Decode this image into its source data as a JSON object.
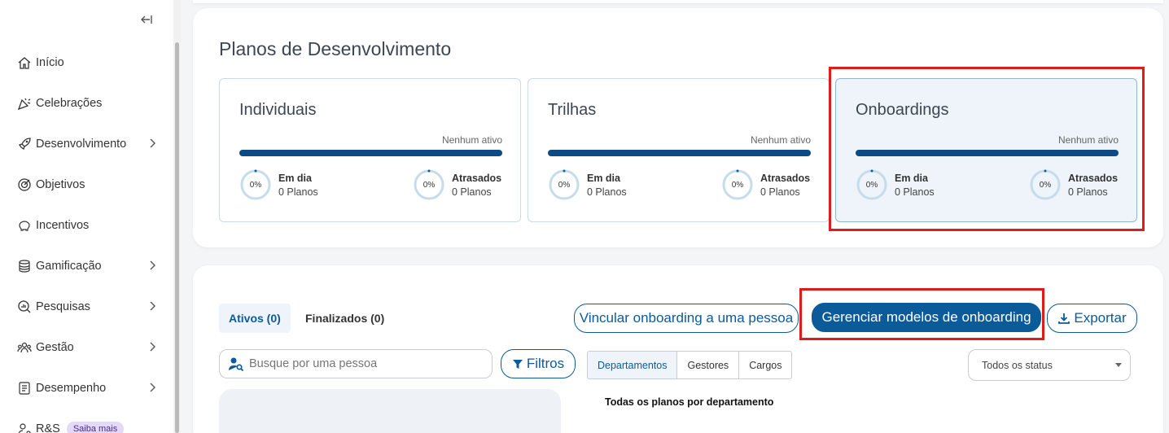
{
  "sidebar": {
    "items": [
      {
        "label": "Início",
        "icon": "home-icon",
        "chevron": false
      },
      {
        "label": "Celebrações",
        "icon": "party-popper-icon",
        "chevron": false
      },
      {
        "label": "Desenvolvimento",
        "icon": "rocket-icon",
        "chevron": true
      },
      {
        "label": "Objetivos",
        "icon": "target-icon",
        "chevron": false
      },
      {
        "label": "Incentivos",
        "icon": "piggy-bank-icon",
        "chevron": false
      },
      {
        "label": "Gamificação",
        "icon": "coin-stack-icon",
        "chevron": true
      },
      {
        "label": "Pesquisas",
        "icon": "magnifier-chart-icon",
        "chevron": true
      },
      {
        "label": "Gestão",
        "icon": "people-group-icon",
        "chevron": true
      },
      {
        "label": "Desempenho",
        "icon": "checklist-icon",
        "chevron": true
      },
      {
        "label": "R&S",
        "icon": "person-search-icon",
        "chevron": false,
        "badge": "Saiba mais"
      }
    ]
  },
  "plans": {
    "title": "Planos de Desenvolvimento",
    "cards": [
      {
        "name": "Individuais",
        "status": "Nenhum ativo",
        "on_time_pct": "0%",
        "on_time_label": "Em dia",
        "on_time_count": "0 Planos",
        "late_pct": "0%",
        "late_label": "Atrasados",
        "late_count": "0 Planos"
      },
      {
        "name": "Trilhas",
        "status": "Nenhum ativo",
        "on_time_pct": "0%",
        "on_time_label": "Em dia",
        "on_time_count": "0 Planos",
        "late_pct": "0%",
        "late_label": "Atrasados",
        "late_count": "0 Planos"
      },
      {
        "name": "Onboardings",
        "status": "Nenhum ativo",
        "on_time_pct": "0%",
        "on_time_label": "Em dia",
        "on_time_count": "0 Planos",
        "late_pct": "0%",
        "late_label": "Atrasados",
        "late_count": "0 Planos"
      }
    ]
  },
  "list": {
    "tabs": [
      "Ativos (0)",
      "Finalizados (0)"
    ],
    "link_button": "Vincular onboarding a uma pessoa",
    "manage_button": "Gerenciar modelos de onboarding",
    "export_button": "Exportar",
    "search_placeholder": "Busque por uma pessoa",
    "filter_button": "Filtros",
    "segments": [
      "Departamentos",
      "Gestores",
      "Cargos"
    ],
    "status_select": "Todos os status",
    "chart_heading": "Todas os planos por departamento"
  },
  "colors": {
    "primary": "#0b5a99",
    "bar": "#0b4a84",
    "highlight": "#e01b1b"
  }
}
